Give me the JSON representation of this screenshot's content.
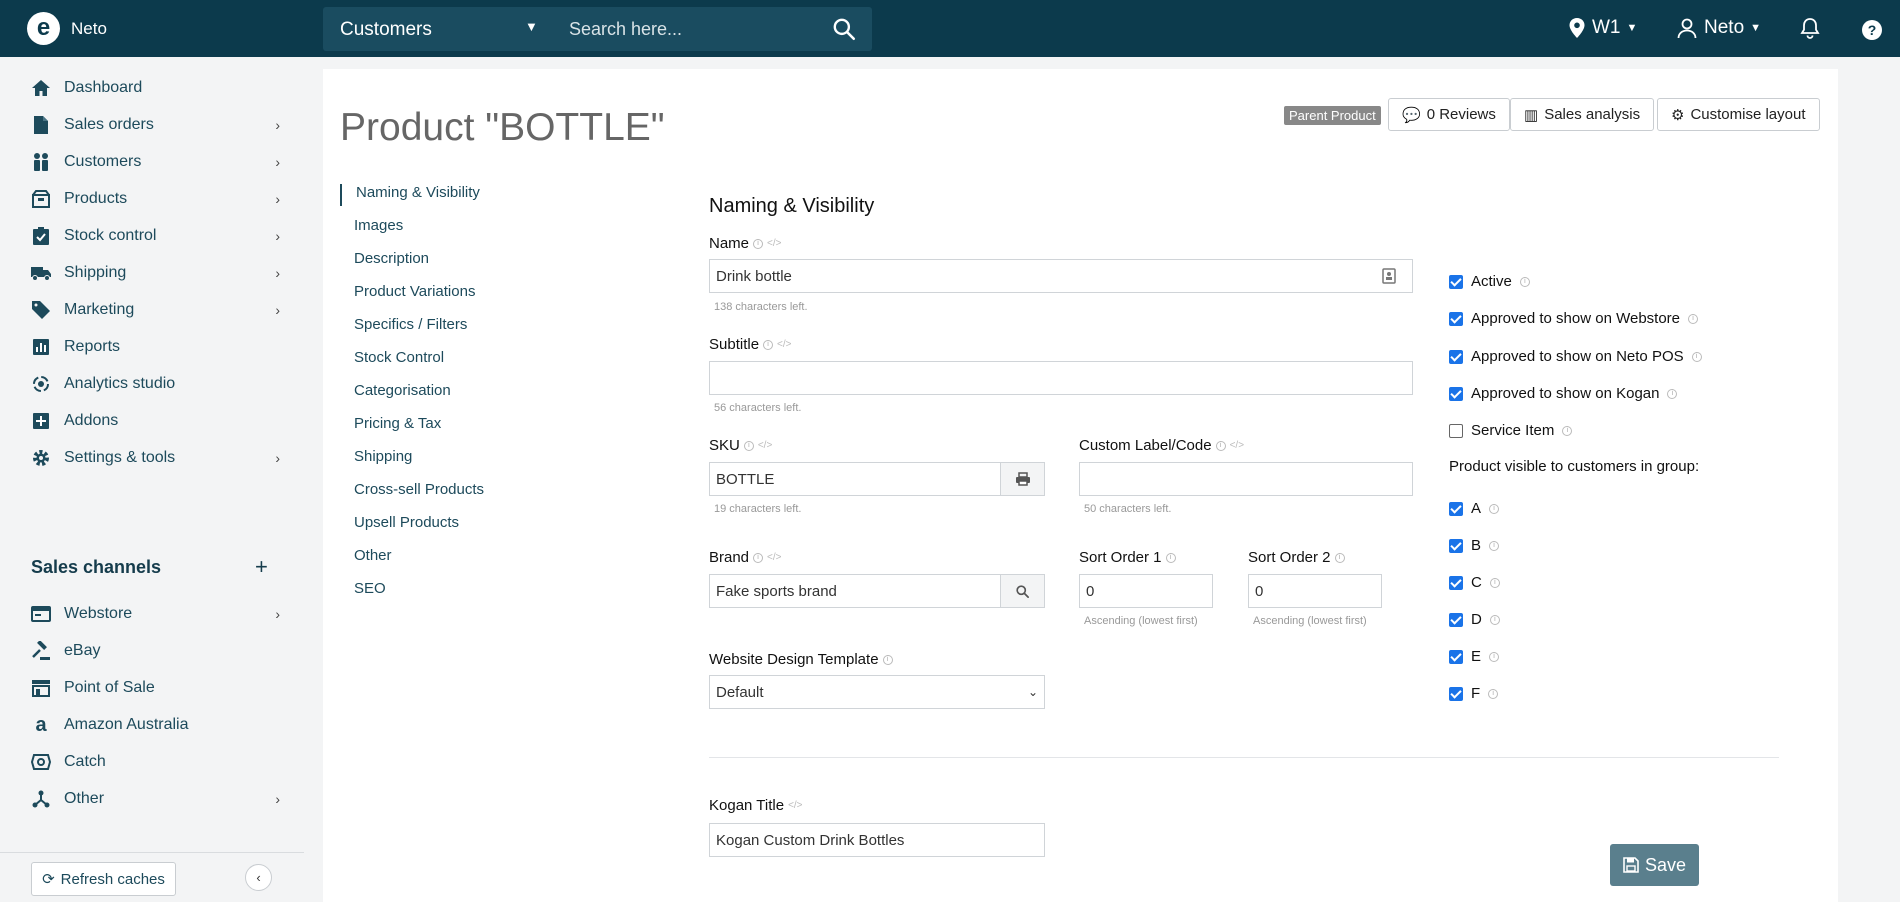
{
  "app": {
    "name": "Neto",
    "logo_letter": "e"
  },
  "topbar": {
    "search_scope": "Customers",
    "search_placeholder": "Search here...",
    "location": "W1",
    "user": "Neto"
  },
  "sidebar": {
    "items": [
      {
        "label": "Dashboard",
        "icon": "home-icon",
        "has_children": false
      },
      {
        "label": "Sales orders",
        "icon": "document-icon",
        "has_children": true
      },
      {
        "label": "Customers",
        "icon": "people-icon",
        "has_children": true
      },
      {
        "label": "Products",
        "icon": "box-icon",
        "has_children": true
      },
      {
        "label": "Stock control",
        "icon": "clipboard-check-icon",
        "has_children": true
      },
      {
        "label": "Shipping",
        "icon": "truck-icon",
        "has_children": true
      },
      {
        "label": "Marketing",
        "icon": "tag-icon",
        "has_children": true
      },
      {
        "label": "Reports",
        "icon": "bar-chart-icon",
        "has_children": false
      },
      {
        "label": "Analytics studio",
        "icon": "analytics-icon",
        "has_children": false
      },
      {
        "label": "Addons",
        "icon": "plus-square-icon",
        "has_children": false
      },
      {
        "label": "Settings & tools",
        "icon": "gear-icon",
        "has_children": true
      }
    ],
    "channels_title": "Sales channels",
    "channels": [
      {
        "label": "Webstore",
        "icon": "browser-icon",
        "has_children": true
      },
      {
        "label": "eBay",
        "icon": "gavel-icon",
        "has_children": false
      },
      {
        "label": "Point of Sale",
        "icon": "store-icon",
        "has_children": false
      },
      {
        "label": "Amazon Australia",
        "icon": "amazon-icon",
        "has_children": false
      },
      {
        "label": "Catch",
        "icon": "catch-icon",
        "has_children": false
      },
      {
        "label": "Other",
        "icon": "network-icon",
        "has_children": true
      }
    ],
    "refresh_label": "Refresh caches"
  },
  "page": {
    "title": "Product \"BOTTLE\"",
    "badge": "Parent Product",
    "reviews_label": "0 Reviews",
    "sales_label": "Sales analysis",
    "customise_label": "Customise layout"
  },
  "subnav": [
    "Naming & Visibility",
    "Images",
    "Description",
    "Product Variations",
    "Specifics / Filters",
    "Stock Control",
    "Categorisation",
    "Pricing & Tax",
    "Shipping",
    "Cross-sell Products",
    "Upsell Products",
    "Other",
    "SEO"
  ],
  "form": {
    "section_title": "Naming & Visibility",
    "name": {
      "label": "Name",
      "value": "Drink bottle",
      "helper": "138 characters left."
    },
    "subtitle": {
      "label": "Subtitle",
      "value": "",
      "helper": "56 characters left."
    },
    "sku": {
      "label": "SKU",
      "value": "BOTTLE",
      "helper": "19 characters left."
    },
    "custom_label": {
      "label": "Custom Label/Code",
      "value": "",
      "helper": "50 characters left."
    },
    "brand": {
      "label": "Brand",
      "value": "Fake sports brand"
    },
    "sort1": {
      "label": "Sort Order 1",
      "value": "0",
      "helper": "Ascending (lowest first)"
    },
    "sort2": {
      "label": "Sort Order 2",
      "value": "0",
      "helper": "Ascending (lowest first)"
    },
    "template": {
      "label": "Website Design Template",
      "value": "Default"
    },
    "kogan_title": {
      "label": "Kogan Title",
      "value": "Kogan Custom Drink Bottles"
    }
  },
  "visibility": {
    "flags": [
      {
        "label": "Active",
        "checked": true
      },
      {
        "label": "Approved to show on Webstore",
        "checked": true
      },
      {
        "label": "Approved to show on Neto POS",
        "checked": true
      },
      {
        "label": "Approved to show on Kogan",
        "checked": true
      },
      {
        "label": "Service Item",
        "checked": false
      }
    ],
    "groups_title": "Product visible to customers in group:",
    "groups": [
      {
        "label": "A",
        "checked": true
      },
      {
        "label": "B",
        "checked": true
      },
      {
        "label": "C",
        "checked": true
      },
      {
        "label": "D",
        "checked": true
      },
      {
        "label": "E",
        "checked": true
      },
      {
        "label": "F",
        "checked": true
      }
    ]
  },
  "save_label": "Save",
  "colors": {
    "topbar": "#0c3a4c",
    "nav_text": "#1d4a5b",
    "save": "#5a7f8d",
    "checkbox": "#1a73e8"
  }
}
